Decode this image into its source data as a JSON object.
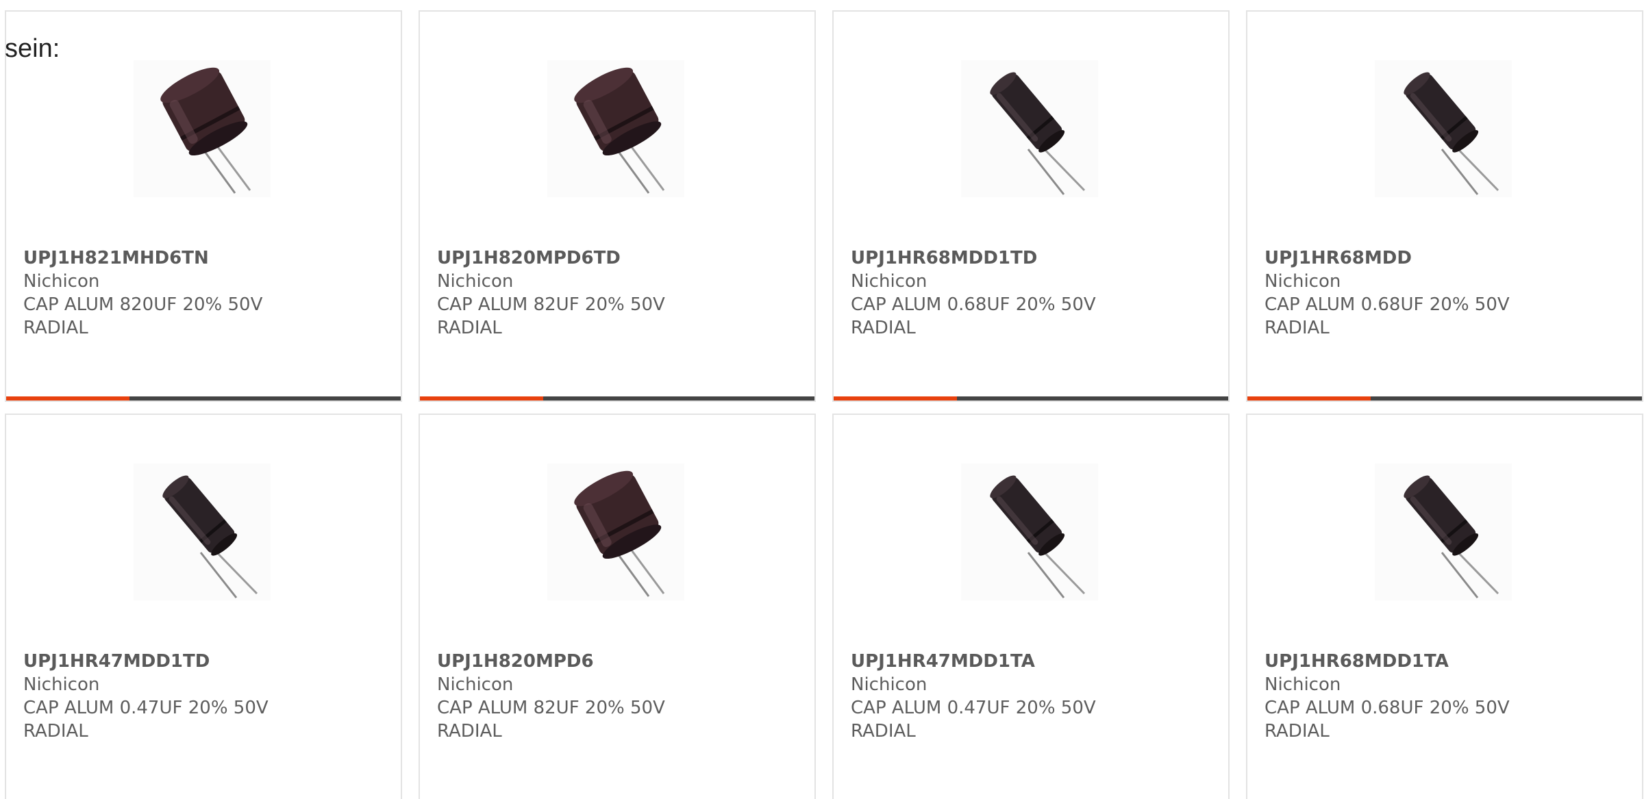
{
  "intro_text": "sein:",
  "colors": {
    "accent": "#e8410e",
    "bar": "#444444",
    "capacitor_body": "#3a2428"
  },
  "products": [
    {
      "part": "UPJ1H821MHD6TN",
      "maker": "Nichicon",
      "desc": "CAP ALUM 820UF 20% 50V\nRADIAL",
      "icon": "capacitor-short-icon"
    },
    {
      "part": "UPJ1H820MPD6TD",
      "maker": "Nichicon",
      "desc": "CAP ALUM 82UF 20% 50V\nRADIAL",
      "icon": "capacitor-short-icon"
    },
    {
      "part": "UPJ1HR68MDD1TD",
      "maker": "Nichicon",
      "desc": "CAP ALUM 0.68UF 20% 50V\nRADIAL",
      "icon": "capacitor-tall-icon"
    },
    {
      "part": "UPJ1HR68MDD",
      "maker": "Nichicon",
      "desc": "CAP ALUM 0.68UF 20% 50V\nRADIAL",
      "icon": "capacitor-tall-icon"
    },
    {
      "part": "UPJ1HR47MDD1TD",
      "maker": "Nichicon",
      "desc": "CAP ALUM 0.47UF 20% 50V\nRADIAL",
      "icon": "capacitor-tall-icon"
    },
    {
      "part": "UPJ1H820MPD6",
      "maker": "Nichicon",
      "desc": "CAP ALUM 82UF 20% 50V\nRADIAL",
      "icon": "capacitor-short-icon"
    },
    {
      "part": "UPJ1HR47MDD1TA",
      "maker": "Nichicon",
      "desc": "CAP ALUM 0.47UF 20% 50V\nRADIAL",
      "icon": "capacitor-tall-icon"
    },
    {
      "part": "UPJ1HR68MDD1TA",
      "maker": "Nichicon",
      "desc": "CAP ALUM 0.68UF 20% 50V\nRADIAL",
      "icon": "capacitor-tall-icon"
    }
  ]
}
